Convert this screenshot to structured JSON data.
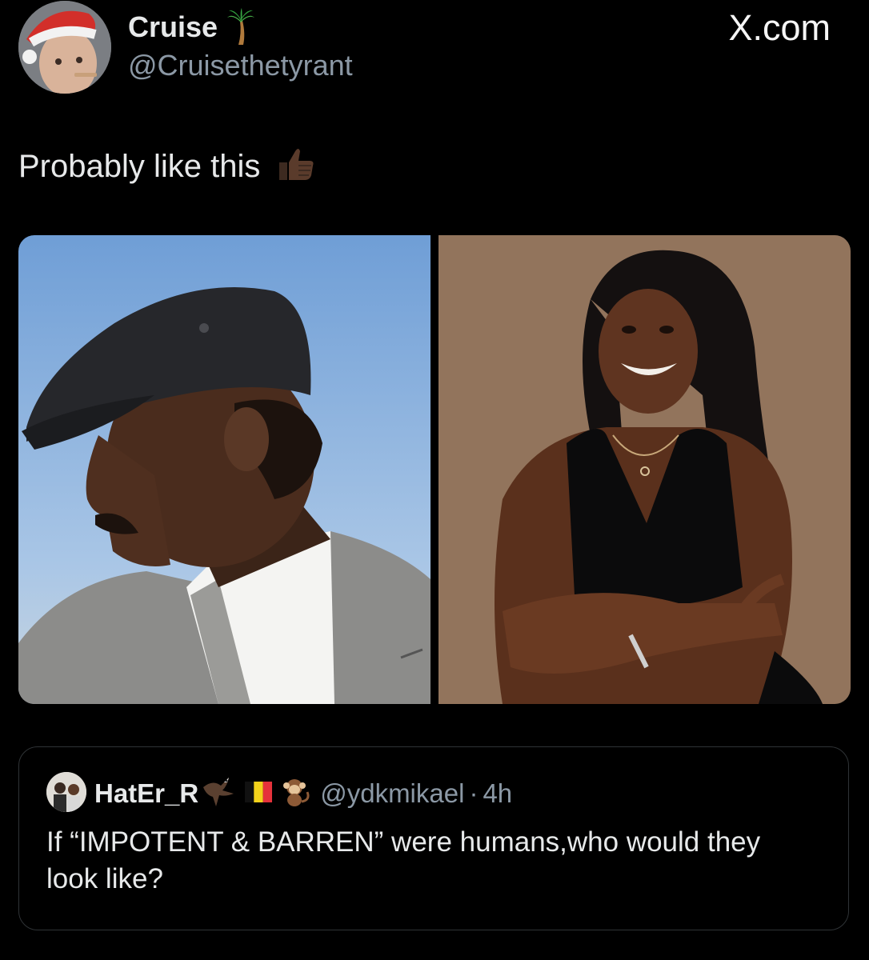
{
  "tweet": {
    "author": {
      "name": "Cruise",
      "name_emoji": "palm-tree-icon",
      "handle": "@Cruisethetyrant"
    },
    "watermark": "X.com",
    "text": "Probably like this",
    "text_emoji": "thumbs-up-icon",
    "media": [
      {
        "description": "photo-man-flat-cap"
      },
      {
        "description": "photo-woman-black-top"
      }
    ]
  },
  "quote": {
    "name": "HatEr_R",
    "name_emojis": [
      "eagle-icon",
      "belgium-flag-icon",
      "monkey-icon"
    ],
    "handle": "@ydkmikael",
    "separator": "·",
    "time": "4h",
    "text": "If “IMPOTENT & BARREN” were humans,who would they look like?"
  },
  "colors": {
    "background": "#000000",
    "text_primary": "#e7e9ea",
    "text_secondary": "#8b98a5",
    "border": "#2f3336"
  }
}
